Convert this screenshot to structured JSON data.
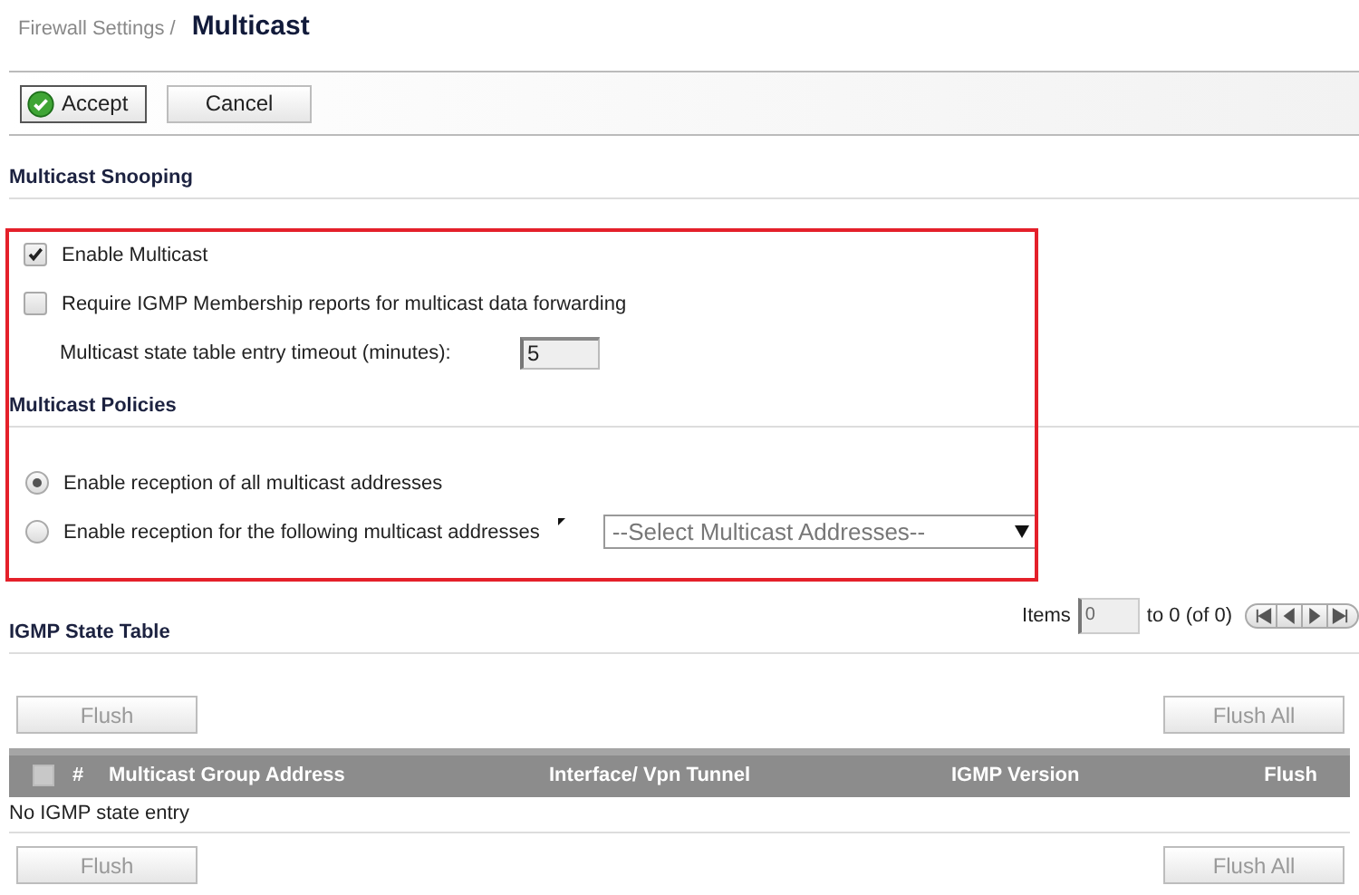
{
  "breadcrumb": {
    "parent": "Firewall Settings /",
    "title": "Multicast"
  },
  "toolbar": {
    "buttons": [
      {
        "label": "Accept",
        "kind": "primary"
      },
      {
        "label": "Cancel",
        "kind": "plain"
      }
    ]
  },
  "snooping": {
    "heading": "Multicast Snooping",
    "options": [
      {
        "label": "Enable Multicast",
        "checked": true
      },
      {
        "label": "Require IGMP Membership reports for multicast data forwarding",
        "checked": false
      }
    ],
    "timeout": {
      "label": "Multicast state table entry timeout (minutes):",
      "value": "5"
    }
  },
  "policies": {
    "heading": "Multicast Policies",
    "options": [
      {
        "label": "Enable reception of all multicast addresses",
        "selected": true
      },
      {
        "label": "Enable reception for the following multicast addresses",
        "selected": false
      }
    ],
    "address_select": {
      "value": "--Select Multicast Addresses--"
    }
  },
  "igmp": {
    "heading": "IGMP State Table",
    "pager": {
      "label": "Items",
      "value": "0",
      "range": "to 0 (of 0)"
    },
    "top_buttons": [
      {
        "label": "Flush",
        "disabled": true
      },
      {
        "label": "Flush All",
        "disabled": true
      }
    ],
    "table": {
      "select_all_checked": false,
      "columns": [
        "#",
        "Multicast Group Address",
        "Interface/ Vpn Tunnel",
        "IGMP Version",
        "Flush"
      ],
      "empty_message": "No IGMP state entry"
    },
    "bottom_buttons": [
      {
        "label": "Flush",
        "disabled": true
      },
      {
        "label": "Flush All",
        "disabled": true
      }
    ]
  }
}
